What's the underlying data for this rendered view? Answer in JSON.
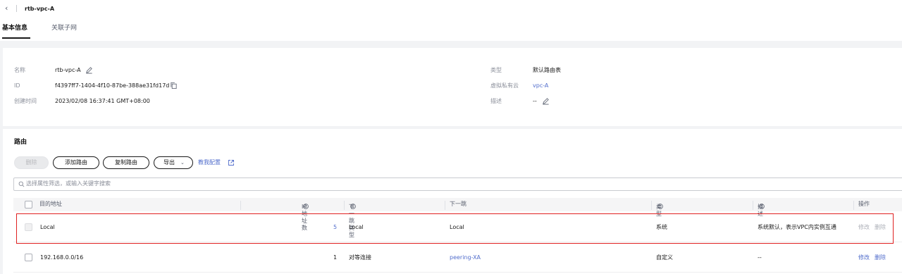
{
  "header": {
    "back_icon": "chevron-left-icon",
    "title": "rtb-vpc-A"
  },
  "tabs": [
    {
      "label": "基本信息",
      "active": true
    },
    {
      "label": "关联子网",
      "active": false
    }
  ],
  "info": {
    "name_label": "名称",
    "name_value": "rtb-vpc-A",
    "id_label": "ID",
    "id_value": "f4397ff7-1404-4f10-87be-388ae31fd17d",
    "created_label": "创建时间",
    "created_value": "2023/02/08 16:37:41 GMT+08:00",
    "type_label": "类型",
    "type_value": "默认路由表",
    "vpc_label": "虚拟私有云",
    "vpc_value": "vpc-A",
    "desc_label": "描述",
    "desc_value": "--"
  },
  "routes": {
    "title": "路由",
    "buttons": {
      "delete": "删除",
      "add": "添加路由",
      "copy": "复制路由",
      "export": "导出"
    },
    "help_link": "教我配置",
    "search_placeholder": "选择属性筛选，或输入关键字搜索",
    "columns": {
      "destination": "目的地址",
      "ip_count": "IP地址数",
      "next_hop_type": "下一跳类型",
      "next_hop": "下一跳",
      "type": "类型",
      "description": "描述",
      "operation": "操作"
    },
    "rows": [
      {
        "destination": "Local",
        "ip_count": "5",
        "next_hop_type": "Local",
        "next_hop": "Local",
        "type": "系统",
        "description": "系统默认，表示VPC内实例互通",
        "modify": "修改",
        "delete": "删除",
        "highlighted": true
      },
      {
        "destination": "192.168.0.0/16",
        "ip_count": "1",
        "next_hop_type": "对等连接",
        "next_hop": "peering-XA",
        "type": "自定义",
        "description": "--",
        "modify": "修改",
        "delete": "删除",
        "highlighted": false
      }
    ]
  },
  "colors": {
    "link": "#526ecc",
    "highlight_border": "#e02020",
    "text": "#191919",
    "label": "#8a8e99"
  }
}
